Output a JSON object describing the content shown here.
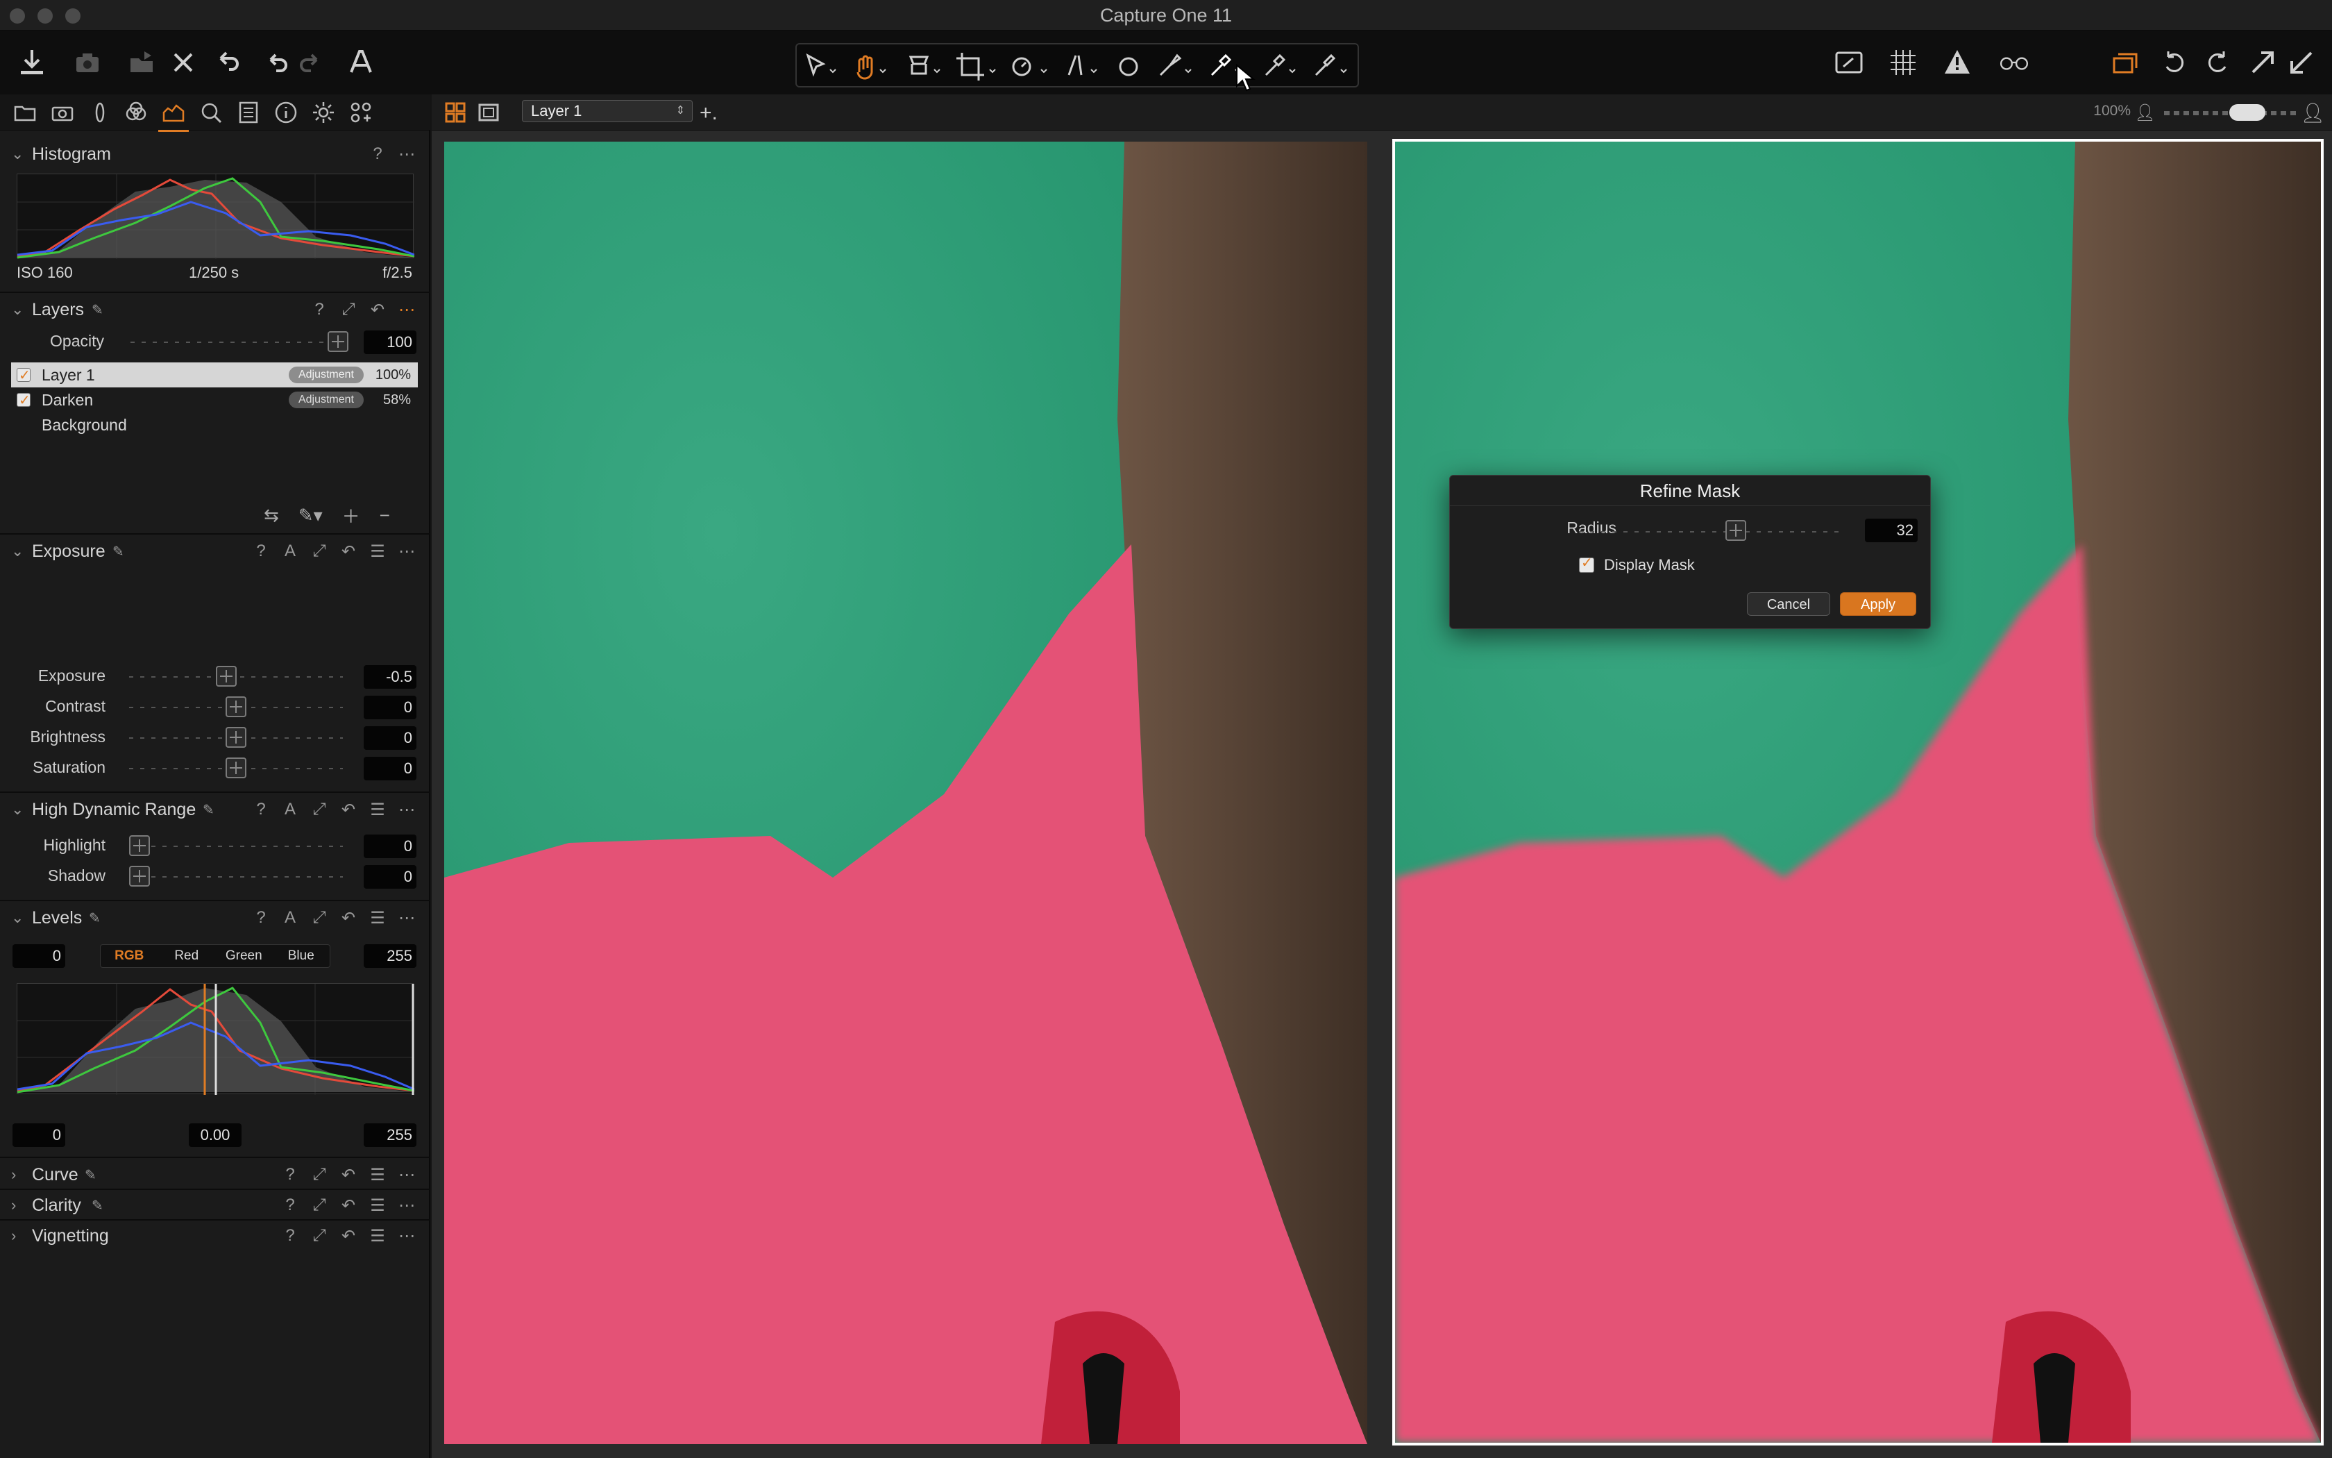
{
  "window": {
    "title": "Capture One 11"
  },
  "toolbar": {
    "left_icons": [
      "import-icon",
      "camera-icon",
      "export-icon",
      "delete-icon",
      "undo-history-icon",
      "undo-icon",
      "redo-icon",
      "text-icon"
    ],
    "cursor_tools": [
      "select-icon",
      "pan-icon",
      "loupe-icon",
      "crop-icon",
      "rotate-icon",
      "keystone-icon",
      "circle-icon",
      "brush-icon",
      "eyedropper-icon",
      "eraser-icon",
      "picker-icon"
    ],
    "right_icons": [
      "proof-icon",
      "grid-icon",
      "warning-icon",
      "glasses-icon",
      "copy-icon",
      "rotate-left-icon",
      "rotate-right-icon",
      "expand-icon",
      "collapse-icon"
    ]
  },
  "tool_tabs": [
    "library-tab",
    "capture-tab",
    "lens-tab",
    "color-tab",
    "exposure-tab",
    "details-tab",
    "metadata-tab",
    "info-tab",
    "settings-tab",
    "styles-tab"
  ],
  "histogram": {
    "title": "Histogram",
    "iso": "ISO 160",
    "shutter": "1/250 s",
    "aperture": "f/2.5"
  },
  "layers": {
    "title": "Layers",
    "opacity_label": "Opacity",
    "opacity_value": "100",
    "opacity_fraction": 1.0,
    "items": [
      {
        "name": "Layer 1",
        "type": "Adjustment",
        "opacity": "100%",
        "checked": true,
        "selected": true
      },
      {
        "name": "Darken",
        "type": "Adjustment",
        "opacity": "58%",
        "checked": true,
        "selected": false
      },
      {
        "name": "Background",
        "type": "",
        "opacity": "",
        "checked": false,
        "selected": false
      }
    ]
  },
  "exposure": {
    "title": "Exposure",
    "rows": [
      {
        "label": "Exposure",
        "value": "-0.5",
        "pos": 0.45
      },
      {
        "label": "Contrast",
        "value": "0",
        "pos": 0.5
      },
      {
        "label": "Brightness",
        "value": "0",
        "pos": 0.5
      },
      {
        "label": "Saturation",
        "value": "0",
        "pos": 0.5
      }
    ]
  },
  "hdr": {
    "title": "High Dynamic Range",
    "rows": [
      {
        "label": "Highlight",
        "value": "0",
        "pos": 0.0
      },
      {
        "label": "Shadow",
        "value": "0",
        "pos": 0.0
      }
    ]
  },
  "levels": {
    "title": "Levels",
    "input_low": "0",
    "input_high": "255",
    "channels": [
      "RGB",
      "Red",
      "Green",
      "Blue"
    ],
    "active_channel": "RGB",
    "output_low": "0",
    "midpoint": "0.00",
    "output_high": "255"
  },
  "collapsed_sections": [
    "Curve",
    "Clarity",
    "Vignetting"
  ],
  "viewer": {
    "layer_select": "Layer 1",
    "zoom": "100%"
  },
  "refine_mask": {
    "title": "Refine Mask",
    "radius_label": "Radius",
    "radius_value": "32",
    "radius_fraction": 0.6,
    "display_mask_label": "Display Mask",
    "display_mask_checked": true,
    "cancel_label": "Cancel",
    "apply_label": "Apply"
  },
  "colors": {
    "accent": "#e07c24",
    "background_green": "#2a9b77",
    "mask_red": "#e45276",
    "skin": "#5e4a3c"
  }
}
